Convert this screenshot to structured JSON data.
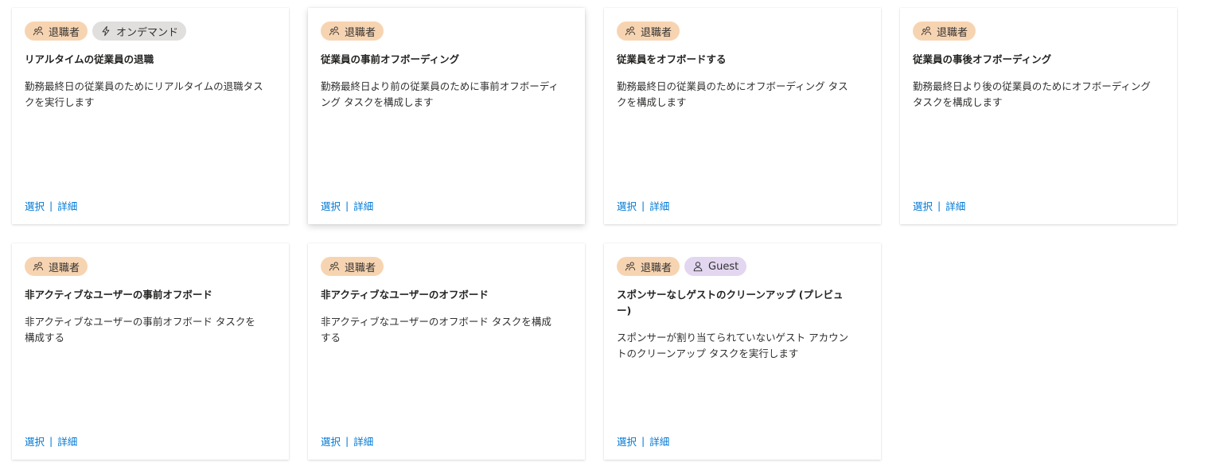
{
  "colors": {
    "leaver_badge": "#f7d4b1",
    "ondemand_badge": "#e1dfdd",
    "guest_badge": "#e2d6f0",
    "link": "#0078d4"
  },
  "cards": [
    {
      "badges": [
        {
          "label": "退職者",
          "icon": "people-icon",
          "kind": "leaver"
        },
        {
          "label": "オンデマンド",
          "icon": "lightning-icon",
          "kind": "ondemand"
        }
      ],
      "title": "リアルタイムの従業員の退職",
      "description": "勤務最終日の従業員のためにリアルタイムの退職タスクを実行します",
      "select_label": "選択",
      "separator": "|",
      "details_label": "詳細"
    },
    {
      "badges": [
        {
          "label": "退職者",
          "icon": "people-icon",
          "kind": "leaver"
        }
      ],
      "title": "従業員の事前オフボーディング",
      "description": "勤務最終日より前の従業員のために事前オフボーディング タスクを構成します",
      "select_label": "選択",
      "separator": "|",
      "details_label": "詳細"
    },
    {
      "badges": [
        {
          "label": "退職者",
          "icon": "people-icon",
          "kind": "leaver"
        }
      ],
      "title": "従業員をオフボードする",
      "description": "勤務最終日の従業員のためにオフボーディング タスクを構成します",
      "select_label": "選択",
      "separator": "|",
      "details_label": "詳細"
    },
    {
      "badges": [
        {
          "label": "退職者",
          "icon": "people-icon",
          "kind": "leaver"
        }
      ],
      "title": "従業員の事後オフボーディング",
      "description": "勤務最終日より後の従業員のためにオフボーディング タスクを構成します",
      "select_label": "選択",
      "separator": "|",
      "details_label": "詳細"
    },
    {
      "badges": [
        {
          "label": "退職者",
          "icon": "people-icon",
          "kind": "leaver"
        }
      ],
      "title": "非アクティブなユーザーの事前オフボード",
      "description": "非アクティブなユーザーの事前オフボード タスクを構成する",
      "select_label": "選択",
      "separator": "|",
      "details_label": "詳細"
    },
    {
      "badges": [
        {
          "label": "退職者",
          "icon": "people-icon",
          "kind": "leaver"
        }
      ],
      "title": "非アクティブなユーザーのオフボード",
      "description": "非アクティブなユーザーのオフボード タスクを構成する",
      "select_label": "選択",
      "separator": "|",
      "details_label": "詳細"
    },
    {
      "badges": [
        {
          "label": "退職者",
          "icon": "people-icon",
          "kind": "leaver"
        },
        {
          "label": "Guest",
          "icon": "person-icon",
          "kind": "guest"
        }
      ],
      "title": "スポンサーなしゲストのクリーンアップ (プレビュー)",
      "description": "スポンサーが割り当てられていないゲスト アカウントのクリーンアップ タスクを実行します",
      "select_label": "選択",
      "separator": "|",
      "details_label": "詳細"
    }
  ]
}
